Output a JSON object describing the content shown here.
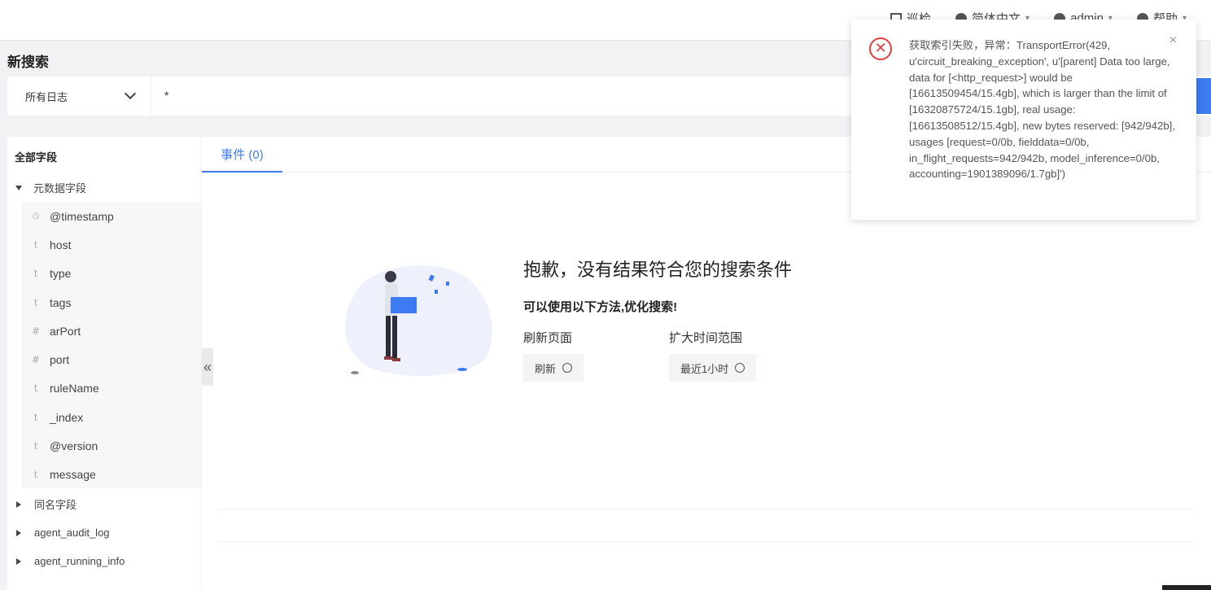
{
  "topbar": {
    "items": [
      {
        "label": "巡检",
        "icon": "monitor-icon"
      },
      {
        "label": "简体中文",
        "icon": "globe-icon"
      },
      {
        "label": "admin",
        "icon": "user-icon"
      },
      {
        "label": "帮助",
        "icon": "help-icon"
      }
    ]
  },
  "page": {
    "title": "新搜索"
  },
  "search": {
    "scope": "所有日志",
    "query": "*"
  },
  "sidebar": {
    "header": "全部字段",
    "meta_group": "元数据字段",
    "fields": [
      {
        "type": "◷",
        "name": "@timestamp"
      },
      {
        "type": "t",
        "name": "host"
      },
      {
        "type": "t",
        "name": "type"
      },
      {
        "type": "t",
        "name": "tags"
      },
      {
        "type": "#",
        "name": "arPort"
      },
      {
        "type": "#",
        "name": "port"
      },
      {
        "type": "t",
        "name": "ruleName"
      },
      {
        "type": "t",
        "name": "_index"
      },
      {
        "type": "t",
        "name": "@version"
      },
      {
        "type": "t",
        "name": "message"
      }
    ],
    "groups": [
      "同名字段",
      "agent_audit_log",
      "agent_running_info"
    ],
    "collapse_glyph": "«"
  },
  "main": {
    "tab": "事件 (0)",
    "empty": {
      "title": "抱歉，没有结果符合您的搜索条件",
      "subtitle": "可以使用以下方法,优化搜索!",
      "option1_label": "刷新页面",
      "option1_button": "刷新",
      "option2_label": "扩大时间范围",
      "option2_button": "最近1小时"
    }
  },
  "notification": {
    "message": "获取索引失败，异常：TransportError(429, u'circuit_breaking_exception', u'[parent] Data too large, data for [<http_request>] would be [16613509454/15.4gb], which is larger than the limit of [16320875724/15.1gb], real usage: [16613508512/15.4gb], new bytes reserved: [942/942b], usages [request=0/0b, fielddata=0/0b, in_flight_requests=942/942b, model_inference=0/0b, accounting=1901389096/1.7gb]')",
    "close_glyph": "×",
    "error_glyph": "✕"
  },
  "colors": {
    "accent": "#3c7bf2",
    "error": "#e23d3d"
  }
}
